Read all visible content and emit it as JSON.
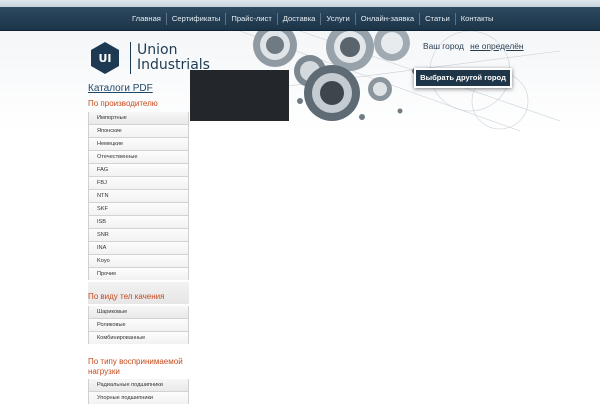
{
  "nav": {
    "items": [
      "Главная",
      "Сертификаты",
      "Прайс-лист",
      "Доставка",
      "Услуги",
      "Онлайн-заявка",
      "Статьи",
      "Контакты"
    ]
  },
  "logo": {
    "mark": "UI",
    "line1": "Union",
    "line2": "Industrials"
  },
  "city": {
    "label": "Ваш город",
    "value": "не определён",
    "button": "Выбрать другой город"
  },
  "sidebar": {
    "catalogs_link": "Каталоги PDF",
    "by_producer": {
      "title": "По производителю",
      "items": [
        "Импортные",
        "Японские",
        "Немецкие",
        "Отечественные",
        "FAG",
        "FBJ",
        "NTN",
        "SKF",
        "ISB",
        "SNR",
        "INA",
        "Koyo",
        "Прочие"
      ]
    },
    "by_rolling": {
      "title": "По виду тел качения",
      "items": [
        "Шариковые",
        "Роликовые",
        "Комбинированные"
      ]
    },
    "by_load": {
      "title": "По типу воспринимаемой нагрузки",
      "items": [
        "Радиальные подшипники",
        "Упорные подшипники"
      ]
    }
  },
  "colors": {
    "nav_bg": "#1c3447",
    "accent_orange": "#c64a1c",
    "brand_blue": "#1e3a52"
  }
}
